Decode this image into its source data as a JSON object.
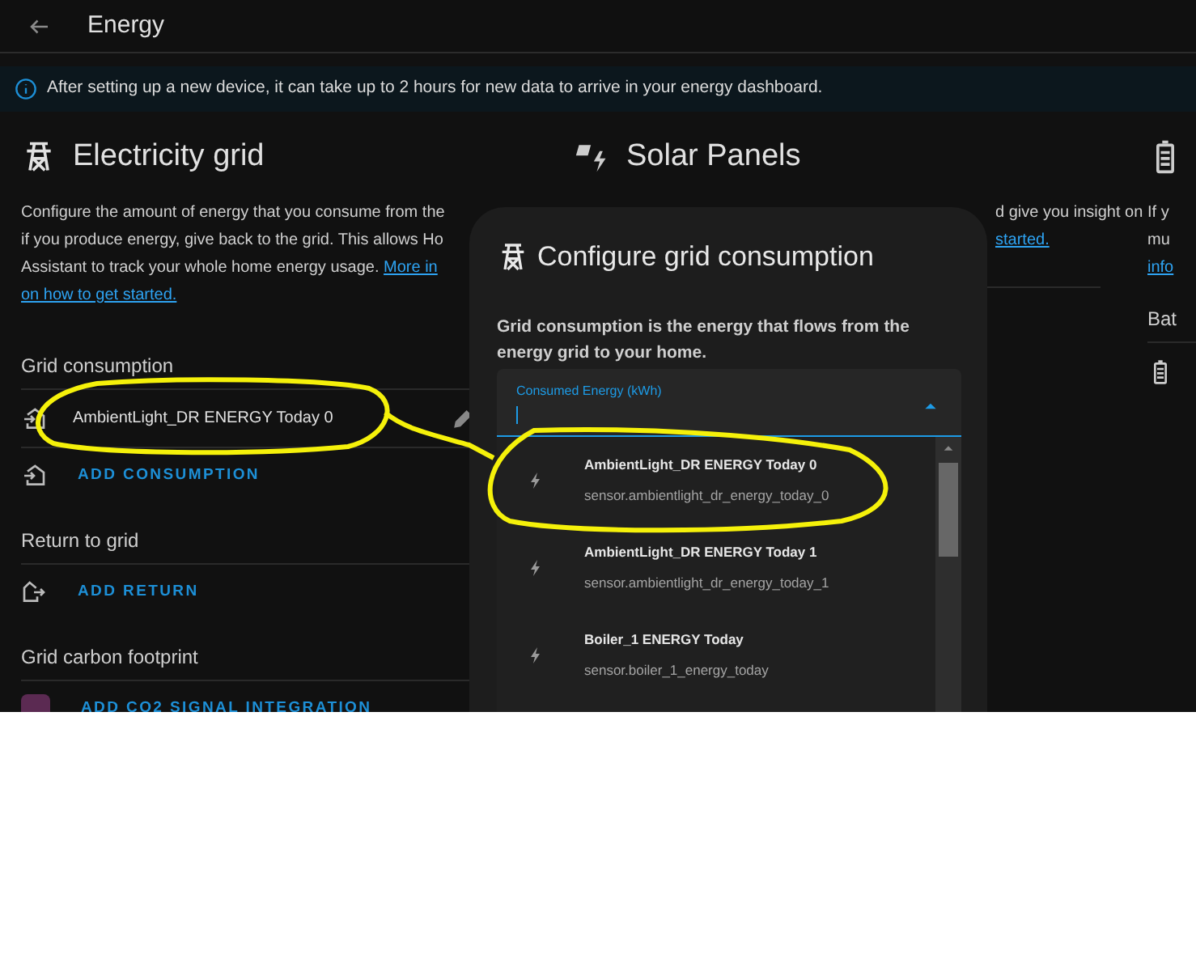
{
  "header": {
    "title": "Energy"
  },
  "info_banner": "After setting up a new device, it can take up to 2 hours for new data to arrive in your energy dashboard.",
  "grid": {
    "title": "Electricity grid",
    "description_lines": [
      {
        "segments": [
          {
            "text": "Configure the amount of energy that you consume from the",
            "kind": "text"
          }
        ]
      },
      {
        "segments": [
          {
            "text": "if you produce energy, give back to the grid. This allows Ho",
            "kind": "text"
          }
        ]
      },
      {
        "segments": [
          {
            "text": "Assistant to track your whole home energy usage. ",
            "kind": "text"
          },
          {
            "text": "More in",
            "kind": "link"
          }
        ]
      },
      {
        "segments": [
          {
            "text": "on how to get started.",
            "kind": "link"
          }
        ]
      }
    ],
    "sections": [
      {
        "title": "Grid consumption",
        "items": [
          "AmbientLight_DR ENERGY Today 0"
        ],
        "add_label": "ADD CONSUMPTION",
        "kind": "import"
      },
      {
        "title": "Return to grid",
        "add_label": "ADD RETURN",
        "kind": "export"
      },
      {
        "title": "Grid carbon footprint",
        "add_label": "ADD CO2 SIGNAL INTEGRATION",
        "kind": "co2"
      }
    ]
  },
  "solar": {
    "title": "Solar Panels",
    "description_lines": [
      {
        "segments": [
          {
            "text": "d give you insight on",
            "kind": "text"
          }
        ]
      },
      {
        "segments": [
          {
            "text": "started.",
            "kind": "link"
          }
        ]
      }
    ]
  },
  "battery": {
    "description_lines": [
      {
        "segments": [
          {
            "text": "If y",
            "kind": "text"
          }
        ]
      },
      {
        "segments": [
          {
            "text": "mu",
            "kind": "text"
          }
        ]
      },
      {
        "segments": [
          {
            "text": "info",
            "kind": "link"
          }
        ]
      }
    ],
    "section_title": "Bat"
  },
  "dialog": {
    "title": "Configure grid consumption",
    "description": "Grid consumption is the energy that flows from the energy grid to your home.",
    "field": {
      "label": "Consumed Energy (kWh)",
      "focused": true
    },
    "options": [
      {
        "name": "AmbientLight_DR ENERGY Today 0",
        "entity": "sensor.ambientlight_dr_energy_today_0"
      },
      {
        "name": "AmbientLight_DR ENERGY Today 1",
        "entity": "sensor.ambientlight_dr_energy_today_1"
      },
      {
        "name": "Boiler_1 ENERGY Today",
        "entity": "sensor.boiler_1_energy_today"
      }
    ]
  }
}
